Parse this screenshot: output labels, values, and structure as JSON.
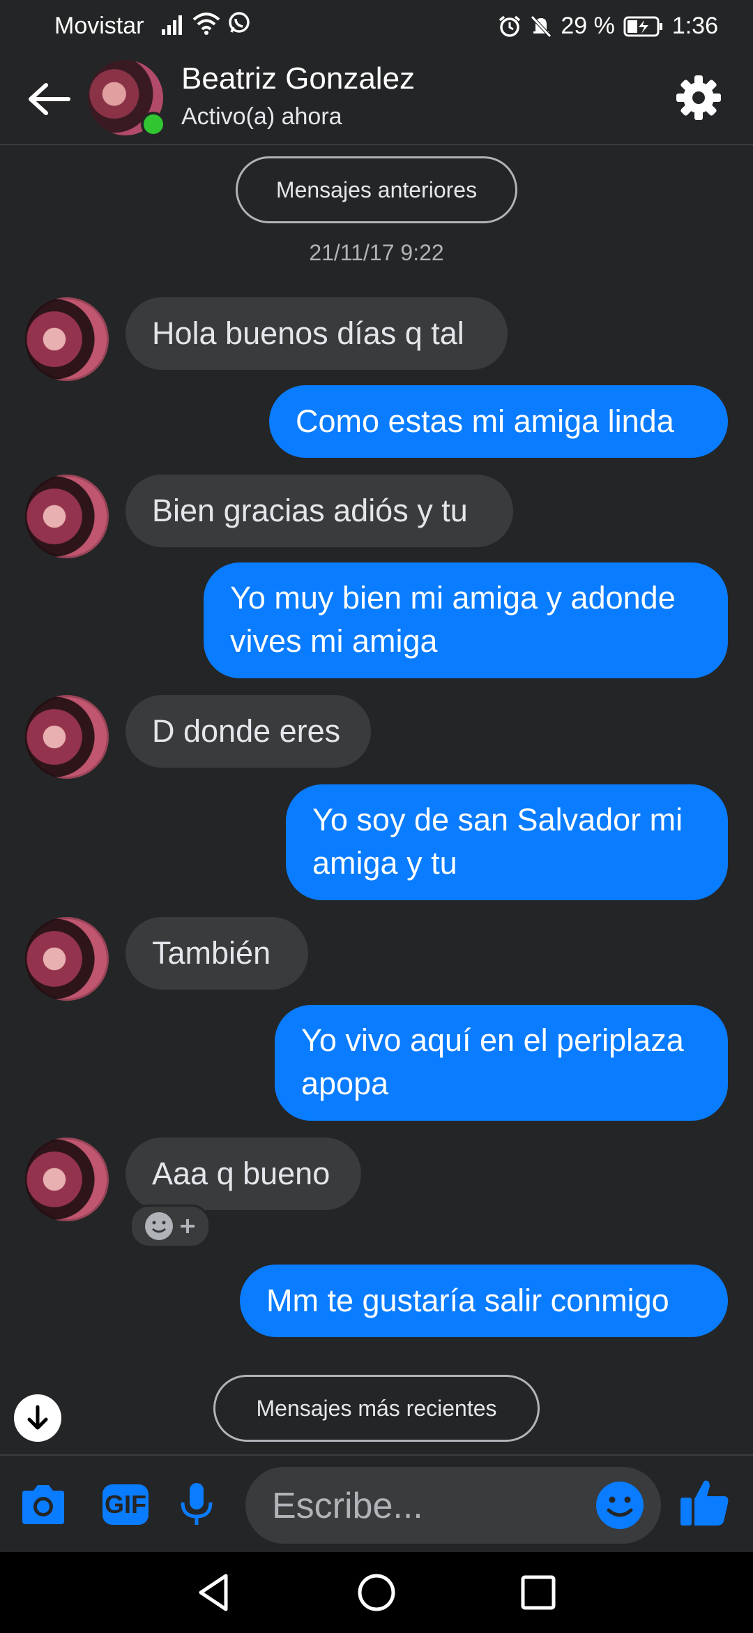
{
  "status_bar": {
    "carrier": "Movistar",
    "battery": "29 %",
    "time": "1:36"
  },
  "header": {
    "contact_name": "Beatriz Gonzalez",
    "status": "Activo(a) ahora"
  },
  "thread": {
    "older_messages_label": "Mensajes anteriores",
    "timestamp": "21/11/17 9:22",
    "newer_messages_label": "Mensajes más recientes",
    "messages": [
      {
        "from": "contact",
        "text": "Hola buenos días q tal"
      },
      {
        "from": "me",
        "text": "Como estas mi amiga linda"
      },
      {
        "from": "contact",
        "text": "Bien gracias adiós y tu"
      },
      {
        "from": "me",
        "text": "Yo muy bien mi amiga y adonde vives mi amiga"
      },
      {
        "from": "contact",
        "text": "D donde eres"
      },
      {
        "from": "me",
        "text": "Yo soy de san Salvador mi amiga y tu"
      },
      {
        "from": "contact",
        "text": "También"
      },
      {
        "from": "me",
        "text": "Yo vivo aquí en el periplaza apopa"
      },
      {
        "from": "contact",
        "text": "Aaa q bueno"
      },
      {
        "from": "me",
        "text": "Mm te gustaría salir conmigo"
      }
    ]
  },
  "composer": {
    "placeholder": "Escribe...",
    "gif_label": "GIF"
  },
  "colors": {
    "accent": "#0a7cff",
    "incoming_bubble": "#3a3b3c",
    "background": "#242526",
    "online": "#31c532"
  }
}
